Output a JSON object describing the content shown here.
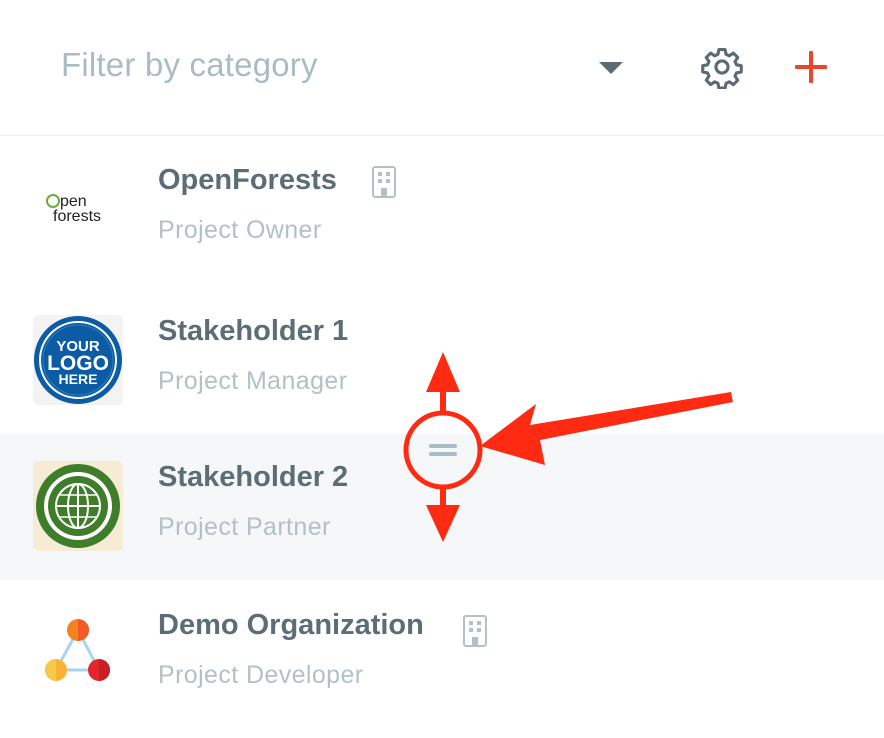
{
  "header": {
    "filter_placeholder": "Filter by category",
    "settings_icon": "gear-icon",
    "add_icon": "plus-icon"
  },
  "colors": {
    "accent": "#e8472b",
    "text_primary": "#5b6e78",
    "text_secondary": "#b2c1c8",
    "placeholder": "#a9bcc6",
    "selected_row": "#f5f7f8",
    "annotation": "#ff2a12"
  },
  "stakeholders": [
    {
      "name": "OpenForests",
      "role": "Project Owner",
      "logo": "openforests-logo",
      "badge": "building-icon"
    },
    {
      "name": "Stakeholder 1",
      "role": "Project Manager",
      "logo": "your-logo-here-badge",
      "logo_lines": [
        "YOUR",
        "LOGO",
        "HERE"
      ]
    },
    {
      "name": "Stakeholder 2",
      "role": "Project Partner",
      "logo": "globe-wreath-logo",
      "selected": true,
      "drag_handle": "drag-handle-icon"
    },
    {
      "name": "Demo Organization",
      "role": "Project Developer",
      "logo": "three-circles-logo",
      "badge": "building-icon"
    }
  ]
}
